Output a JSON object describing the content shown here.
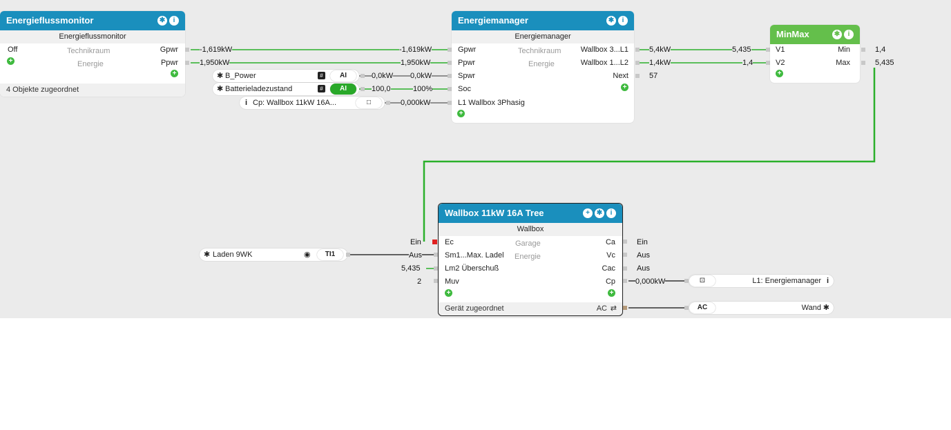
{
  "colors": {
    "header_blue": "#1a8fbd",
    "header_green": "#64bf4b",
    "wire_green": "#2bb02b",
    "wire_dark": "#333333",
    "active": "#e02020"
  },
  "efm": {
    "title": "Energieflussmonitor",
    "subtitle": "Energieflussmonitor",
    "in_off": "Off",
    "room": "Technikraum",
    "category": "Energie",
    "out_gpwr": "Gpwr",
    "out_ppwr": "Ppwr",
    "footer": "4 Objekte zugeordnet",
    "val_gpwr": "-1,619kW",
    "val_ppwr": "1,950kW"
  },
  "em": {
    "title": "Energiemanager",
    "subtitle": "Energiemanager",
    "in_gpwr": "Gpwr",
    "in_ppwr": "Ppwr",
    "in_spwr": "Spwr",
    "in_soc": "Soc",
    "in_l1": "L1 Wallbox 3Phasig",
    "room": "Technikraum",
    "category": "Energie",
    "out_l1": "Wallbox 3...L1",
    "out_l2": "Wallbox 1...L2",
    "out_next": "Next",
    "val_gpwr": "-1,619kW",
    "val_ppwr": "1,950kW",
    "val_spwr_a": "0,0kW",
    "val_spwr_b": "0,0kW",
    "val_soc_a": "100,0",
    "val_soc_b": "100%",
    "val_l1in": "0,000kW",
    "val_l1": "5,4kW",
    "val_l2": "1,4kW",
    "val_next": "57"
  },
  "bpower": {
    "label": "B_Power",
    "tag": "#",
    "badge": "AI"
  },
  "batt": {
    "label": "Batterieladezustand",
    "tag": "#",
    "badge": "AI"
  },
  "cp": {
    "label": "Cp: Wallbox 11kW 16A...",
    "icon": "i"
  },
  "minmax": {
    "title": "MinMax",
    "in_v1": "V1",
    "in_v2": "V2",
    "out_min": "Min",
    "out_max": "Max",
    "val_v1": "5,435",
    "val_v2": "1,4",
    "val_min": "1,4",
    "val_max": "5,435"
  },
  "wb": {
    "title": "Wallbox 11kW 16A Tree",
    "subtitle": "Wallbox",
    "in_ec": "Ec",
    "in_sm": "Sm1...Max. Ladel",
    "in_lm2": "Lm2 Überschuß",
    "in_muv": "Muv",
    "room": "Garage",
    "category": "Energie",
    "out_ca": "Ca",
    "out_vc": "Vc",
    "out_cac": "Cac",
    "out_cp": "Cp",
    "footer": "Gerät zugeordnet",
    "footer_ac": "AC",
    "lbl_ein": "Ein",
    "lbl_aus": "Aus",
    "lbl_5435": "5,435",
    "lbl_2": "2",
    "out_val_ca": "Ein",
    "out_val_vc": "Aus",
    "out_val_cac": "Aus",
    "out_val_cp": "0,000kW"
  },
  "laden": {
    "label": "Laden 9WK",
    "badge": "TI1"
  },
  "l1pill": {
    "label": "L1: Energiemanager",
    "icon": "i"
  },
  "acpill": {
    "badge": "AC",
    "label": "Wand"
  }
}
